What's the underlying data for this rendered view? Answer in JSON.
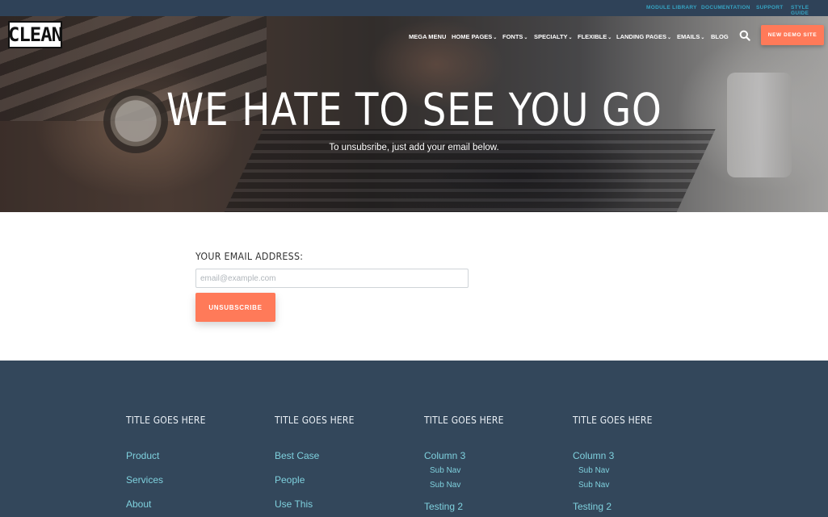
{
  "topbar": {
    "links": [
      "MODULE LIBRARY",
      "DOCUMENTATION",
      "SUPPORT",
      "STYLE GUIDE"
    ]
  },
  "header": {
    "logo_text": "CLEAN",
    "nav": [
      {
        "label": "MEGA MENU",
        "dropdown": false
      },
      {
        "label": "HOME PAGES",
        "dropdown": true
      },
      {
        "label": "FONTS",
        "dropdown": true
      },
      {
        "label": "SPECIALTY",
        "dropdown": true
      },
      {
        "label": "FLEXIBLE",
        "dropdown": true
      },
      {
        "label": "LANDING PAGES",
        "dropdown": true
      },
      {
        "label": "EMAILS",
        "dropdown": true
      },
      {
        "label": "BLOG",
        "dropdown": false
      }
    ],
    "search_icon": "search-icon",
    "cta_label": "NEW DEMO SITE"
  },
  "hero": {
    "title": "WE HATE TO SEE YOU GO",
    "subtitle": "To unsubsribe, just add your email below."
  },
  "form": {
    "label": "YOUR EMAIL ADDRESS:",
    "email_placeholder": "email@example.com",
    "email_value": "",
    "submit_label": "UNSUBSCRIBE"
  },
  "footer": {
    "columns": [
      {
        "title": "TITLE GOES HERE",
        "links": [
          "Product",
          "Services",
          "About"
        ]
      },
      {
        "title": "TITLE GOES HERE",
        "links": [
          "Best Case",
          "People",
          "Use This"
        ]
      },
      {
        "title": "TITLE GOES HERE",
        "links": [
          "Column 3",
          "Testing 2"
        ],
        "sublinks": [
          "Sub Nav",
          "Sub Nav"
        ]
      },
      {
        "title": "TITLE GOES HERE",
        "links": [
          "Column 3",
          "Testing 2"
        ],
        "sublinks": [
          "Sub Nav",
          "Sub Nav"
        ]
      }
    ]
  },
  "colors": {
    "accent": "#ff7a59",
    "footer_bg": "#33475b",
    "topbar_bg": "#2f4258",
    "link": "#7fd1de"
  }
}
